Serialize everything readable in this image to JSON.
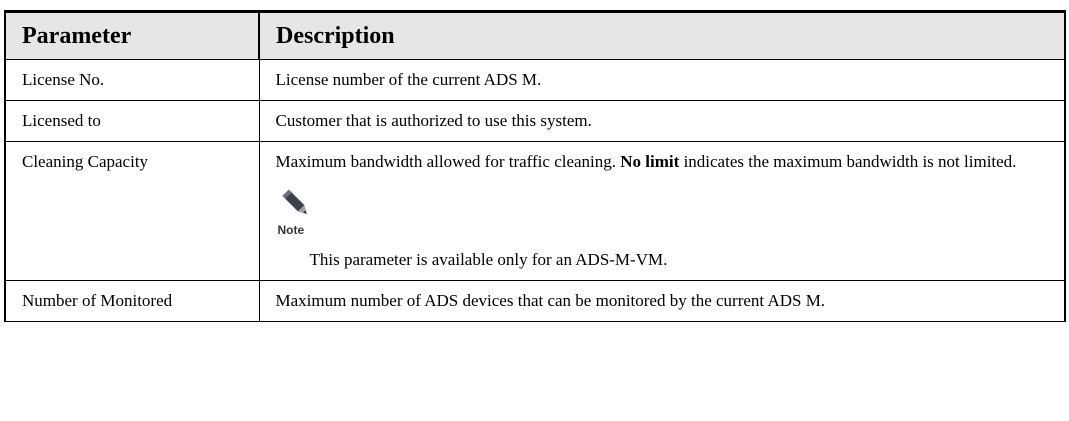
{
  "table": {
    "headers": {
      "parameter": "Parameter",
      "description": "Description"
    },
    "rows": [
      {
        "parameter": "License No.",
        "description": "License number of the current ADS M."
      },
      {
        "parameter": "Licensed to",
        "description": "Customer that is authorized to use this system."
      },
      {
        "parameter": "Cleaning Capacity",
        "description_before": "Maximum bandwidth allowed for traffic cleaning. ",
        "description_bold": "No limit",
        "description_after": " indicates the maximum bandwidth is not limited.",
        "note_label": "Note",
        "note_icon": "pencil-icon",
        "note_text": "This parameter is available only for an ADS-M-VM."
      },
      {
        "parameter": "Number of Monitored",
        "description": "Maximum number of ADS devices that can be monitored by the current ADS M."
      }
    ]
  }
}
